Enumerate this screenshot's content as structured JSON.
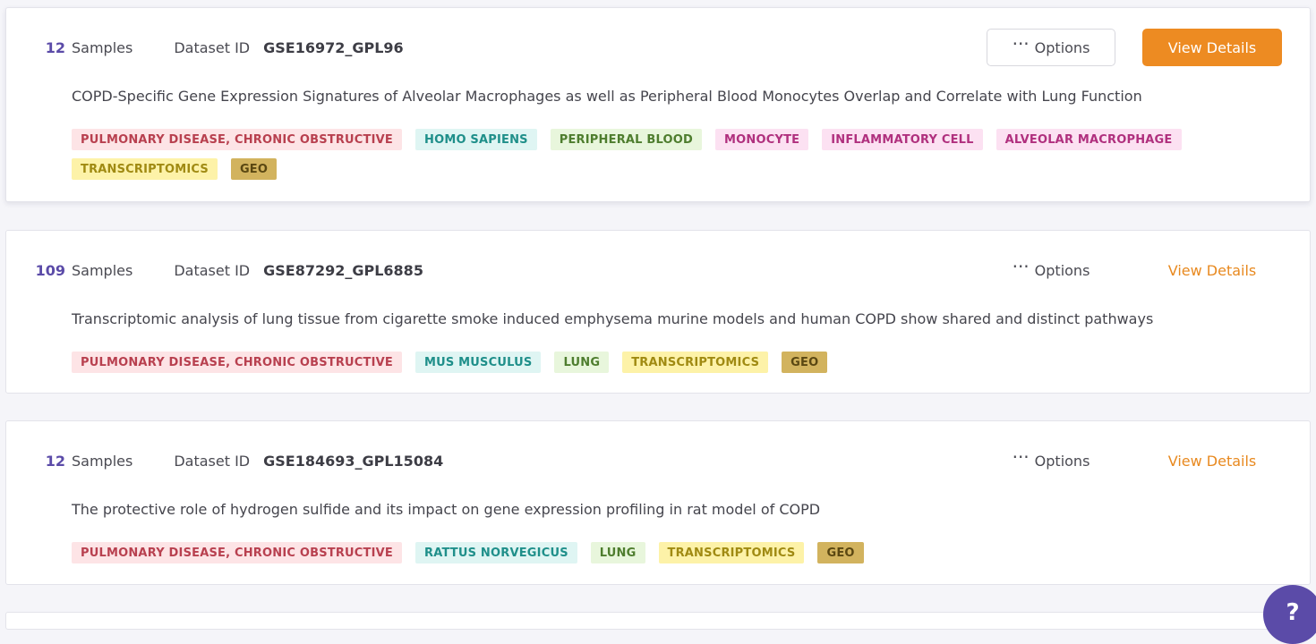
{
  "datasets": [
    {
      "samples_count": "12",
      "samples_label": "Samples",
      "dataset_id_label": "Dataset ID",
      "dataset_id": "GSE16972_GPL96",
      "options_label": "Options",
      "view_label": "View Details",
      "title": "COPD-Specific Gene Expression Signatures of Alveolar Macrophages as well as Peripheral Blood Monocytes Overlap and Correlate with Lung Function",
      "tags": [
        {
          "label": "PULMONARY DISEASE, CHRONIC OBSTRUCTIVE",
          "kind": "disease"
        },
        {
          "label": "HOMO SAPIENS",
          "kind": "species"
        },
        {
          "label": "PERIPHERAL BLOOD",
          "kind": "tissue"
        },
        {
          "label": "MONOCYTE",
          "kind": "cell"
        },
        {
          "label": "INFLAMMATORY CELL",
          "kind": "cell"
        },
        {
          "label": "ALVEOLAR MACROPHAGE",
          "kind": "cell"
        },
        {
          "label": "TRANSCRIPTOMICS",
          "kind": "omics"
        },
        {
          "label": "GEO",
          "kind": "source"
        }
      ]
    },
    {
      "samples_count": "109",
      "samples_label": "Samples",
      "dataset_id_label": "Dataset ID",
      "dataset_id": "GSE87292_GPL6885",
      "options_label": "Options",
      "view_label": "View Details",
      "title": "Transcriptomic analysis of lung tissue from cigarette smoke induced emphysema murine models and human COPD show shared and distinct pathways",
      "tags": [
        {
          "label": "PULMONARY DISEASE, CHRONIC OBSTRUCTIVE",
          "kind": "disease"
        },
        {
          "label": "MUS MUSCULUS",
          "kind": "species"
        },
        {
          "label": "LUNG",
          "kind": "tissue"
        },
        {
          "label": "TRANSCRIPTOMICS",
          "kind": "omics"
        },
        {
          "label": "GEO",
          "kind": "source"
        }
      ]
    },
    {
      "samples_count": "12",
      "samples_label": "Samples",
      "dataset_id_label": "Dataset ID",
      "dataset_id": "GSE184693_GPL15084",
      "options_label": "Options",
      "view_label": "View Details",
      "title": "The protective role of hydrogen sulfide and its impact on gene expression profiling in rat model of COPD",
      "tags": [
        {
          "label": "PULMONARY DISEASE, CHRONIC OBSTRUCTIVE",
          "kind": "disease"
        },
        {
          "label": "RATTUS NORVEGICUS",
          "kind": "species"
        },
        {
          "label": "LUNG",
          "kind": "tissue"
        },
        {
          "label": "TRANSCRIPTOMICS",
          "kind": "omics"
        },
        {
          "label": "GEO",
          "kind": "source"
        }
      ]
    }
  ],
  "icons": {
    "options": "more-horizontal-icon",
    "help": "help-icon"
  },
  "help_fab_label": "?"
}
